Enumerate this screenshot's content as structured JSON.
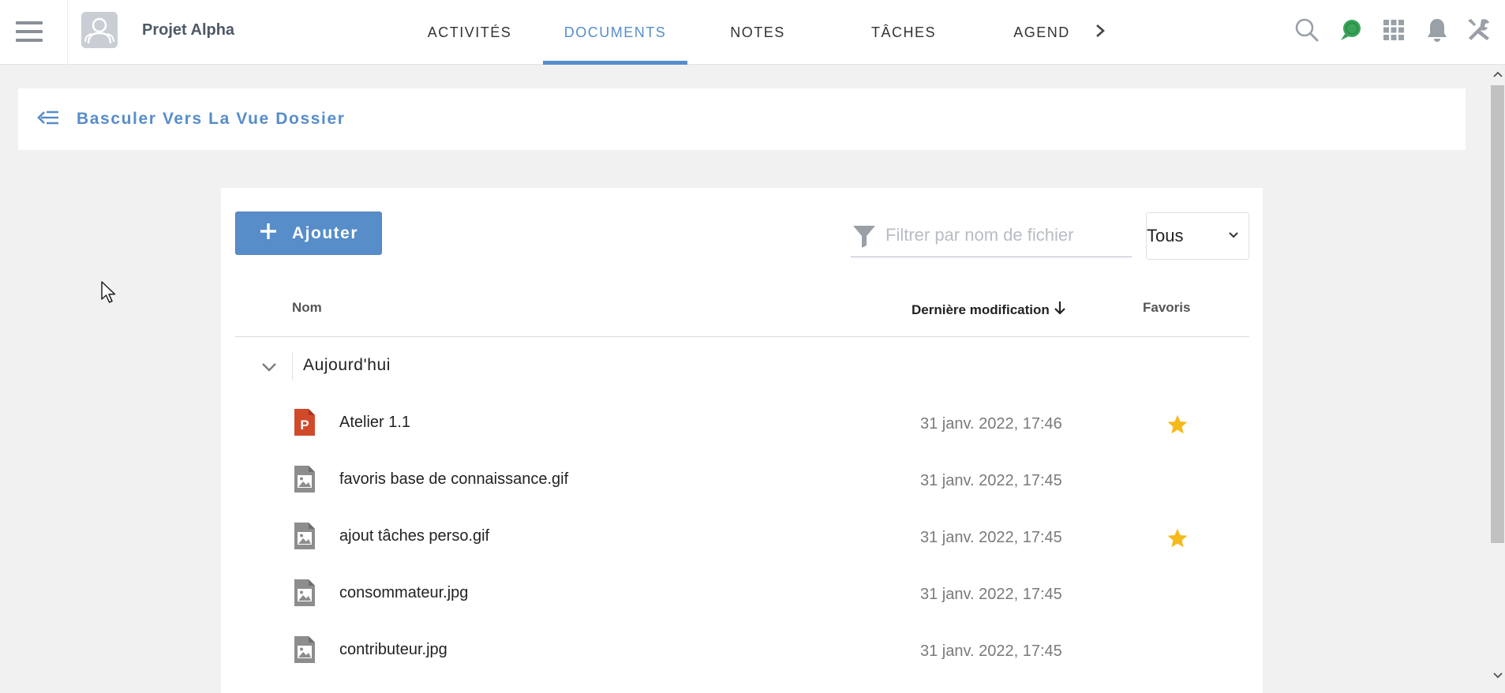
{
  "topbar": {
    "space_name": "Projet Alpha",
    "tabs": [
      {
        "label": "ACTIVITÉS",
        "active": false
      },
      {
        "label": "DOCUMENTS",
        "active": true
      },
      {
        "label": "NOTES",
        "active": false
      },
      {
        "label": "TÂCHES",
        "active": false
      },
      {
        "label": "AGEND",
        "active": false
      }
    ],
    "icons": [
      "menu-icon",
      "search-icon",
      "chat-icon",
      "apps-grid-icon",
      "bell-icon",
      "tools-icon"
    ],
    "accent_color": "#578dc9"
  },
  "toggle": {
    "label": "Basculer Vers La Vue Dossier",
    "icon": "back-list-icon"
  },
  "toolbar": {
    "add_label": "Ajouter",
    "filter_placeholder": "Filtrer par nom de fichier",
    "filter_value": "",
    "select_value": "Tous"
  },
  "table": {
    "columns": {
      "name": "Nom",
      "modified": "Dernière modification",
      "favorites": "Favoris"
    },
    "sort": {
      "column": "modified",
      "direction": "desc"
    },
    "group": {
      "label": "Aujourd'hui",
      "expanded": true
    },
    "rows": [
      {
        "name": "Atelier 1.1",
        "date": "31 janv. 2022, 17:46",
        "type": "powerpoint",
        "favorite": true
      },
      {
        "name": "favoris base de connaissance.gif",
        "date": "31 janv. 2022, 17:45",
        "type": "image",
        "favorite": false
      },
      {
        "name": "ajout tâches perso.gif",
        "date": "31 janv. 2022, 17:45",
        "type": "image",
        "favorite": true
      },
      {
        "name": "consommateur.jpg",
        "date": "31 janv. 2022, 17:45",
        "type": "image",
        "favorite": false
      },
      {
        "name": "contributeur.jpg",
        "date": "31 janv. 2022, 17:45",
        "type": "image",
        "favorite": false
      }
    ]
  },
  "colors": {
    "star": "#f6b91c",
    "ppt": "#d04a2a",
    "image_icon": "#8d8d8d"
  }
}
